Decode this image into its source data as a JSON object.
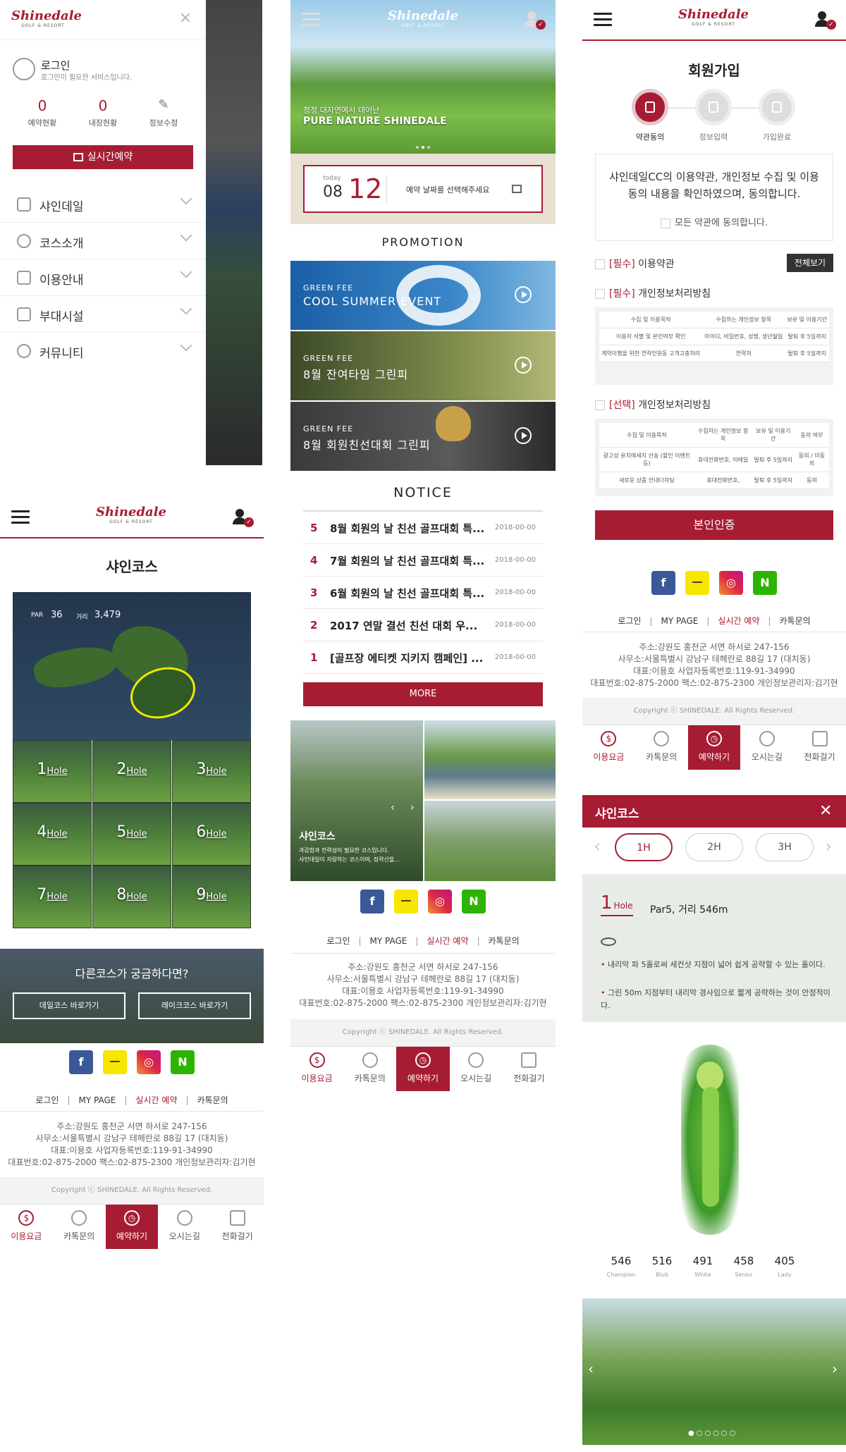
{
  "brand": {
    "logo": "Shinedale",
    "logo_sub": "GOLF & RESORT",
    "accent": "#a61d33"
  },
  "menu_drawer": {
    "login_title": "로그인",
    "login_sub": "로그인이 필요한 서비스입니다.",
    "stats": [
      {
        "value": "0",
        "label": "예약현황"
      },
      {
        "value": "0",
        "label": "내장현황"
      },
      {
        "label": "정보수정",
        "icon": "pencil-icon"
      }
    ],
    "cta": "실시간예약",
    "items": [
      {
        "label": "샤인데일",
        "icon": "building-icon"
      },
      {
        "label": "코스소개",
        "icon": "palette-icon"
      },
      {
        "label": "이용안내",
        "icon": "list-icon"
      },
      {
        "label": "부대시설",
        "icon": "facility-icon"
      },
      {
        "label": "커뮤니티",
        "icon": "apple-icon"
      }
    ]
  },
  "home": {
    "hero_small": "청정 대자연에서 태어난",
    "hero_big": "PURE NATURE SHINEDALE",
    "today_label": "today",
    "month": "08",
    "day": "12",
    "date_prompt": "예약 날짜를 선택해주세요",
    "promotion_title": "PROMOTION",
    "promotions": [
      {
        "kicker": "GREEN FEE",
        "title": "COOL SUMMER EVENT"
      },
      {
        "kicker": "GREEN FEE",
        "title": "8월 잔여타임 그린피"
      },
      {
        "kicker": "GREEN FEE",
        "title": "8월 회원친선대회 그린피"
      }
    ],
    "notice_title": "NOTICE",
    "notices": [
      {
        "num": "5",
        "title": "8월 회원의 날 친선 골프대회 특...",
        "date": "2018-00-00"
      },
      {
        "num": "4",
        "title": "7월 회원의 날 친선 골프대회 특...",
        "date": "2018-00-00"
      },
      {
        "num": "3",
        "title": "6월 회원의 날 친선 골프대회 특...",
        "date": "2018-00-00"
      },
      {
        "num": "2",
        "title": "2017 연말 결선 친선 대회 우...",
        "date": "2018-00-00"
      },
      {
        "num": "1",
        "title": "[골프장 에티켓 지키지 캠페인] ...",
        "date": "2018-00-00"
      }
    ],
    "more": "MORE",
    "gallery_title": "샤인코스",
    "gallery_desc": "과감함과 전략성이 필요한 코스입니다.\n샤인데일이 자랑하는 코스이며, 장락산을..."
  },
  "signup": {
    "title": "회원가입",
    "steps": [
      "약관동의",
      "정보입력",
      "가입완료"
    ],
    "intro": "샤인데일CC의 이용약관, 개인정보 수집 및 이용동의 내용을 확인하였으며, 동의합니다.",
    "agree_all": "모든 약관에 동의합니다.",
    "required_tag": "[필수]",
    "optional_tag": "[선택]",
    "terms": "이용약관",
    "view_all": "전체보기",
    "privacy": "개인정보처리방침",
    "privacy_table_head": [
      "수집 및 이용목적",
      "수집하는 개인정보 항목",
      "보유 및 이용기간"
    ],
    "privacy_table_rows": [
      [
        "이용자 식별 및 본인여부 확인",
        "아이디, 비밀번호, 성명, 생년월일",
        "탈퇴 후 5일까지"
      ],
      [
        "계약이행을 위한 연락인원동 고객고충처리",
        "연락처",
        "탈퇴 후 5일까지"
      ]
    ],
    "opt_table_head": [
      "수집 및 이용목적",
      "수집하는 개인정보 항목",
      "보유 및 이용기간",
      "동의 여부"
    ],
    "opt_table_rows": [
      [
        "광고성 유치에세지 선송 (할인 이벤트등)",
        "휴대전화번호, 이메일",
        "탈퇴 후 5일까지",
        "동의 / 미동의"
      ],
      [
        "새로운 상품 안내다차팅",
        "휴대전화번호,",
        "탈퇴 후 5일까지",
        "동의"
      ]
    ],
    "verify_btn": "본인인증"
  },
  "course": {
    "title": "샤인코스",
    "par_label": "PAR",
    "par": "36",
    "dist_label": "거리",
    "distance": "3,479",
    "holes": [
      "1",
      "2",
      "3",
      "4",
      "5",
      "6",
      "7",
      "8",
      "9"
    ],
    "hole_suffix": "Hole",
    "other_title": "다른코스가 궁금하다면?",
    "other_buttons": [
      "데일코스 바로가기",
      "레이크코스 바로가기"
    ]
  },
  "hole_detail": {
    "title": "샤인코스",
    "tabs": [
      "1H",
      "2H",
      "3H"
    ],
    "hole_no": "1",
    "hole_word": "Hole",
    "info": "Par5, 거리 546m",
    "tips": [
      "내리막 파 5홀로써 세컨샷 지점이 넓어 쉽게 공략할 수 있는 홀이다.",
      "그린 50m 지점부터 내리막 경사임으로 짧게 공략하는 것이 안정적이다."
    ],
    "distances": [
      {
        "value": "546",
        "label": "Champion"
      },
      {
        "value": "516",
        "label": "Blub"
      },
      {
        "value": "491",
        "label": "White"
      },
      {
        "value": "458",
        "label": "Senior"
      },
      {
        "value": "405",
        "label": "Lady"
      }
    ]
  },
  "footer": {
    "links": [
      "로그인",
      "MY PAGE",
      "실시간 예약",
      "카톡문의"
    ],
    "address": "주소:강원도 홍천군 서면 하서로 247-156",
    "office": "사무소:서울특별시 강남구 테헤란로 88길 17 (대치동)",
    "ceo": "대표:이용호 사업자등록번호:119-91-34990",
    "phone": "대표번호:02-875-2000 팩스:02-875-2300 개인정보관리자:김기현",
    "copyright": "Copyright ⓒ SHINEDALE. All Rights Reserved."
  },
  "social": [
    "f",
    "ㅡ",
    "◎",
    "N"
  ],
  "tabbar": [
    {
      "label": "이용요금",
      "icon": "won-icon"
    },
    {
      "label": "카톡문의",
      "icon": "chat-icon"
    },
    {
      "label": "예약하기",
      "icon": "clock-icon"
    },
    {
      "label": "오시는길",
      "icon": "map-pin-icon"
    },
    {
      "label": "전화걸기",
      "icon": "phone-icon"
    }
  ]
}
